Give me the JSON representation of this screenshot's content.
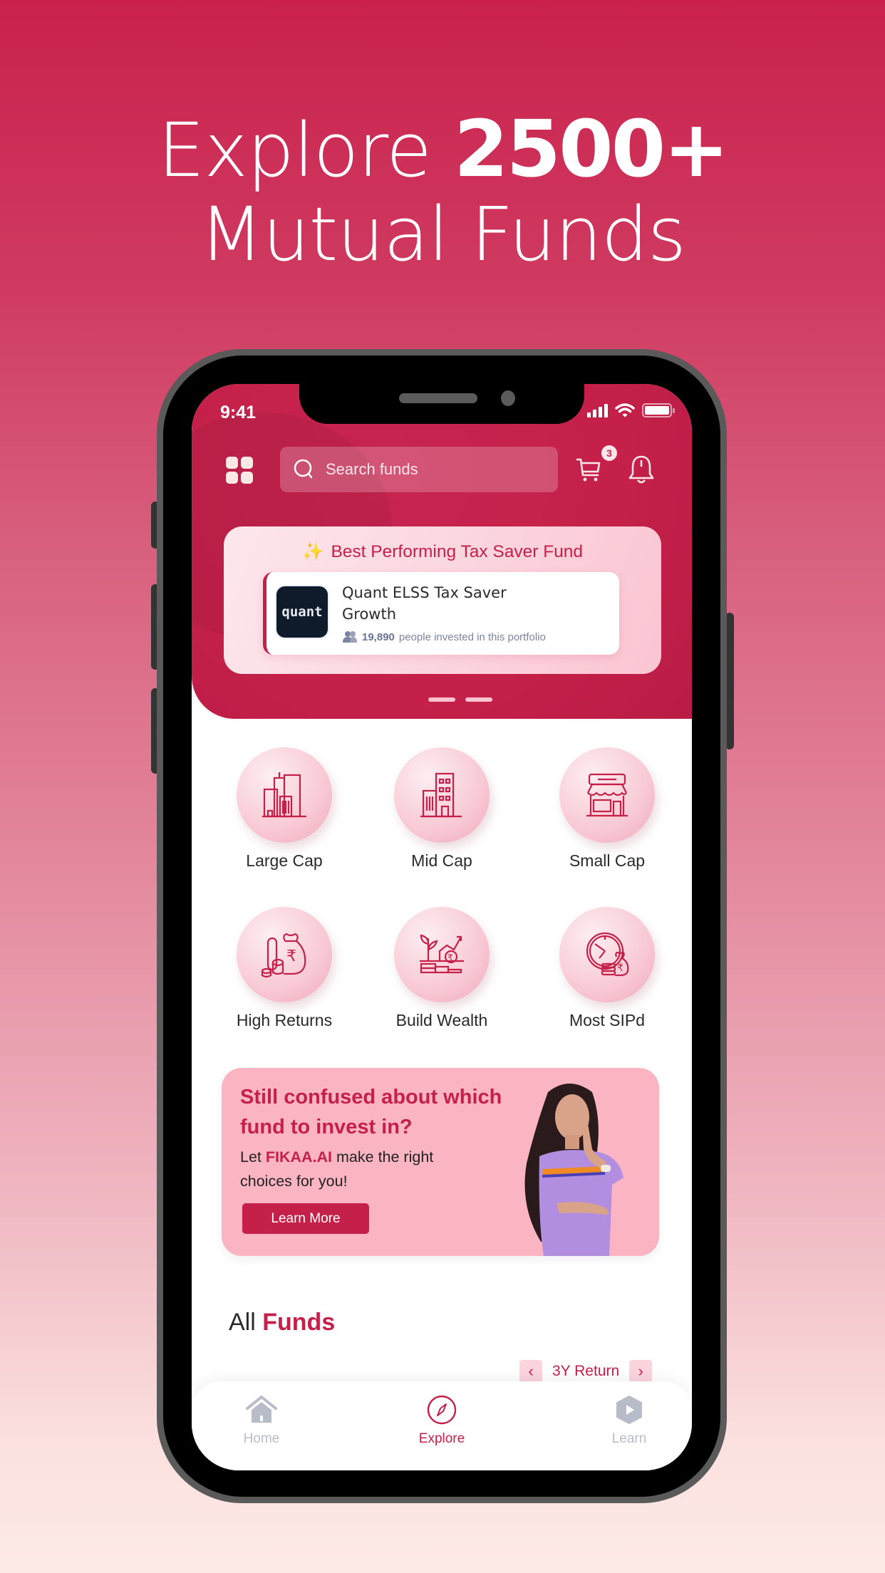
{
  "headline": {
    "prefix": "Explore",
    "highlight": "2500+",
    "line2": "Mutual Funds"
  },
  "status_bar": {
    "time": "9:41",
    "icons": [
      "signal-icon",
      "wifi-icon",
      "battery-icon"
    ]
  },
  "header": {
    "menu_icon": "grid-icon",
    "search_placeholder": "Search funds",
    "search_value": "",
    "cart_badge": "3",
    "icons": [
      "search-icon",
      "cart-icon",
      "bell-icon"
    ]
  },
  "promo": {
    "icon": "sparkles-icon",
    "title": "Best Performing Tax Saver Fund",
    "fund": {
      "logo_text": "quant",
      "name": "Quant ELSS Tax Saver Growth",
      "investors_count": "19,890",
      "investors_text": "people invested in this portfolio"
    },
    "carousel": {
      "total": 3,
      "active_index": 0
    }
  },
  "categories": [
    {
      "label": "Large Cap",
      "icon": "skyscrapers-icon"
    },
    {
      "label": "Mid Cap",
      "icon": "office-building-icon"
    },
    {
      "label": "Small Cap",
      "icon": "storefront-icon"
    },
    {
      "label": "High Returns",
      "icon": "money-bag-rupee-icon"
    },
    {
      "label": "Build Wealth",
      "icon": "growth-plant-icon"
    },
    {
      "label": "Most SIPd",
      "icon": "clock-money-icon"
    }
  ],
  "ai_banner": {
    "title": "Still confused about which fund to invest in?",
    "sub_prefix": "Let ",
    "brand": "FIKAA.AI",
    "sub_suffix": " make the right choices for you!",
    "button": "Learn More"
  },
  "all_funds": {
    "title_prefix": "All",
    "title_highlight": "Funds",
    "sort_label": "3Y Return"
  },
  "tabbar": {
    "tabs": [
      {
        "label": "Home",
        "icon": "home-icon",
        "active": false
      },
      {
        "label": "Explore",
        "icon": "compass-icon",
        "active": true
      },
      {
        "label": "Learn",
        "icon": "play-hexagon-icon",
        "active": false
      }
    ]
  },
  "colors": {
    "brand": "#c42049",
    "brand_light": "#fbb4c2",
    "inactive": "#b8bcc8"
  }
}
